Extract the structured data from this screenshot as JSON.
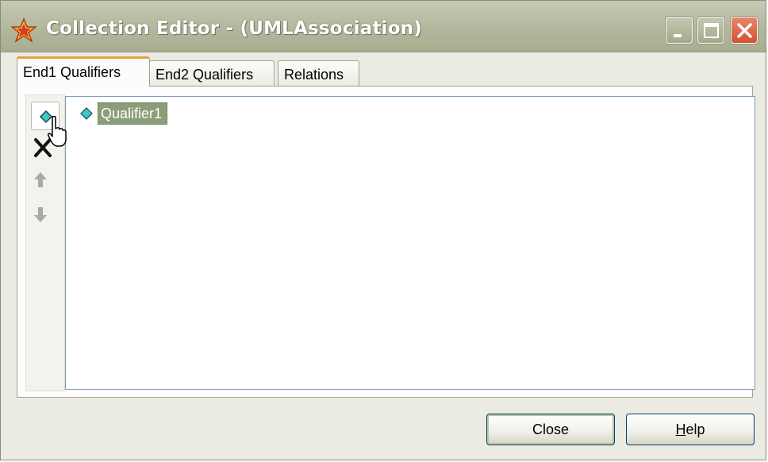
{
  "window": {
    "title": "Collection Editor - (UMLAssociation)",
    "icon": "star-icon",
    "controls": [
      "minimize-icon",
      "maximize-icon",
      "close-icon"
    ],
    "accent": "#e6a03c"
  },
  "tabs": [
    {
      "label": "End1 Qualifiers",
      "active": true
    },
    {
      "label": "End2 Qualifiers",
      "active": false
    },
    {
      "label": "Relations",
      "active": false
    }
  ],
  "toolbar": {
    "items": [
      "add-qualifier-icon",
      "delete-icon",
      "move-up-icon",
      "move-down-icon"
    ]
  },
  "list": {
    "items": [
      {
        "label": "Qualifier1",
        "icon": "qualifier-diamond-icon",
        "selected": true
      }
    ],
    "selection_color": "#8a9e78"
  },
  "buttons": {
    "close_label": "Close",
    "help_mnemonic": "H",
    "help_rest": "elp"
  }
}
